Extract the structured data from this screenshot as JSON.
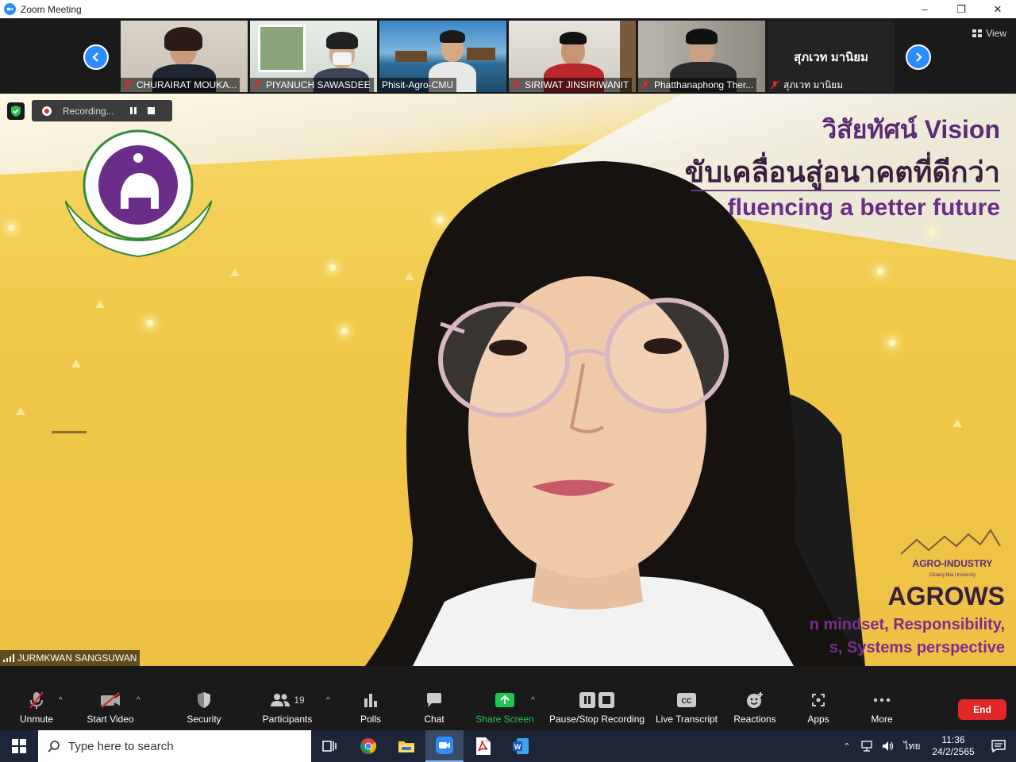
{
  "window": {
    "title": "Zoom Meeting",
    "minimize": "–",
    "restore": "❐",
    "close": "✕"
  },
  "strip": {
    "view_label": "View",
    "thumbnails": [
      {
        "name": "CHURAIRAT MOUKA..."
      },
      {
        "name": "PIYANUCH SAWASDEE"
      },
      {
        "name": "Phisit-Agro-CMU"
      },
      {
        "name": "SIRIWAT JINSIRIWANIT"
      },
      {
        "name": "Phatthanaphong Ther..."
      },
      {
        "name": "สุภเวท มานิยม",
        "display_name": "สุภเวท มานิยม"
      }
    ]
  },
  "recording": {
    "label": "Recording..."
  },
  "main": {
    "speaker": "JURMKWAN SANGSUWAN",
    "slide": {
      "title": "วิสัยทัศน์ Vision",
      "subtitle_th": "ขับเคลื่อนสู่อนาคตที่ดีกว่า",
      "subtitle_en": "fluencing a better future",
      "brand_line": "AGRO-INDUSTRY",
      "brand_sub": "Chiang Mai University",
      "acronym": "AGROWS",
      "line1": "n mindset, Responsibility,",
      "line2": "s, Systems perspective"
    }
  },
  "toolbar": {
    "unmute": "Unmute",
    "start_video": "Start Video",
    "security": "Security",
    "participants": "Participants",
    "participants_count": "19",
    "polls": "Polls",
    "chat": "Chat",
    "share_screen": "Share Screen",
    "pause_stop": "Pause/Stop Recording",
    "live_transcript": "Live Transcript",
    "reactions": "Reactions",
    "apps": "Apps",
    "more": "More",
    "end": "End"
  },
  "taskbar": {
    "search_placeholder": "Type here to search",
    "language": "ไทย",
    "time": "11:36",
    "date": "24/2/2565"
  },
  "colors": {
    "zoom_blue": "#2d8cff",
    "end_red": "#e02828",
    "share_green": "#23c552",
    "slide_purple": "#6a2d8a"
  }
}
